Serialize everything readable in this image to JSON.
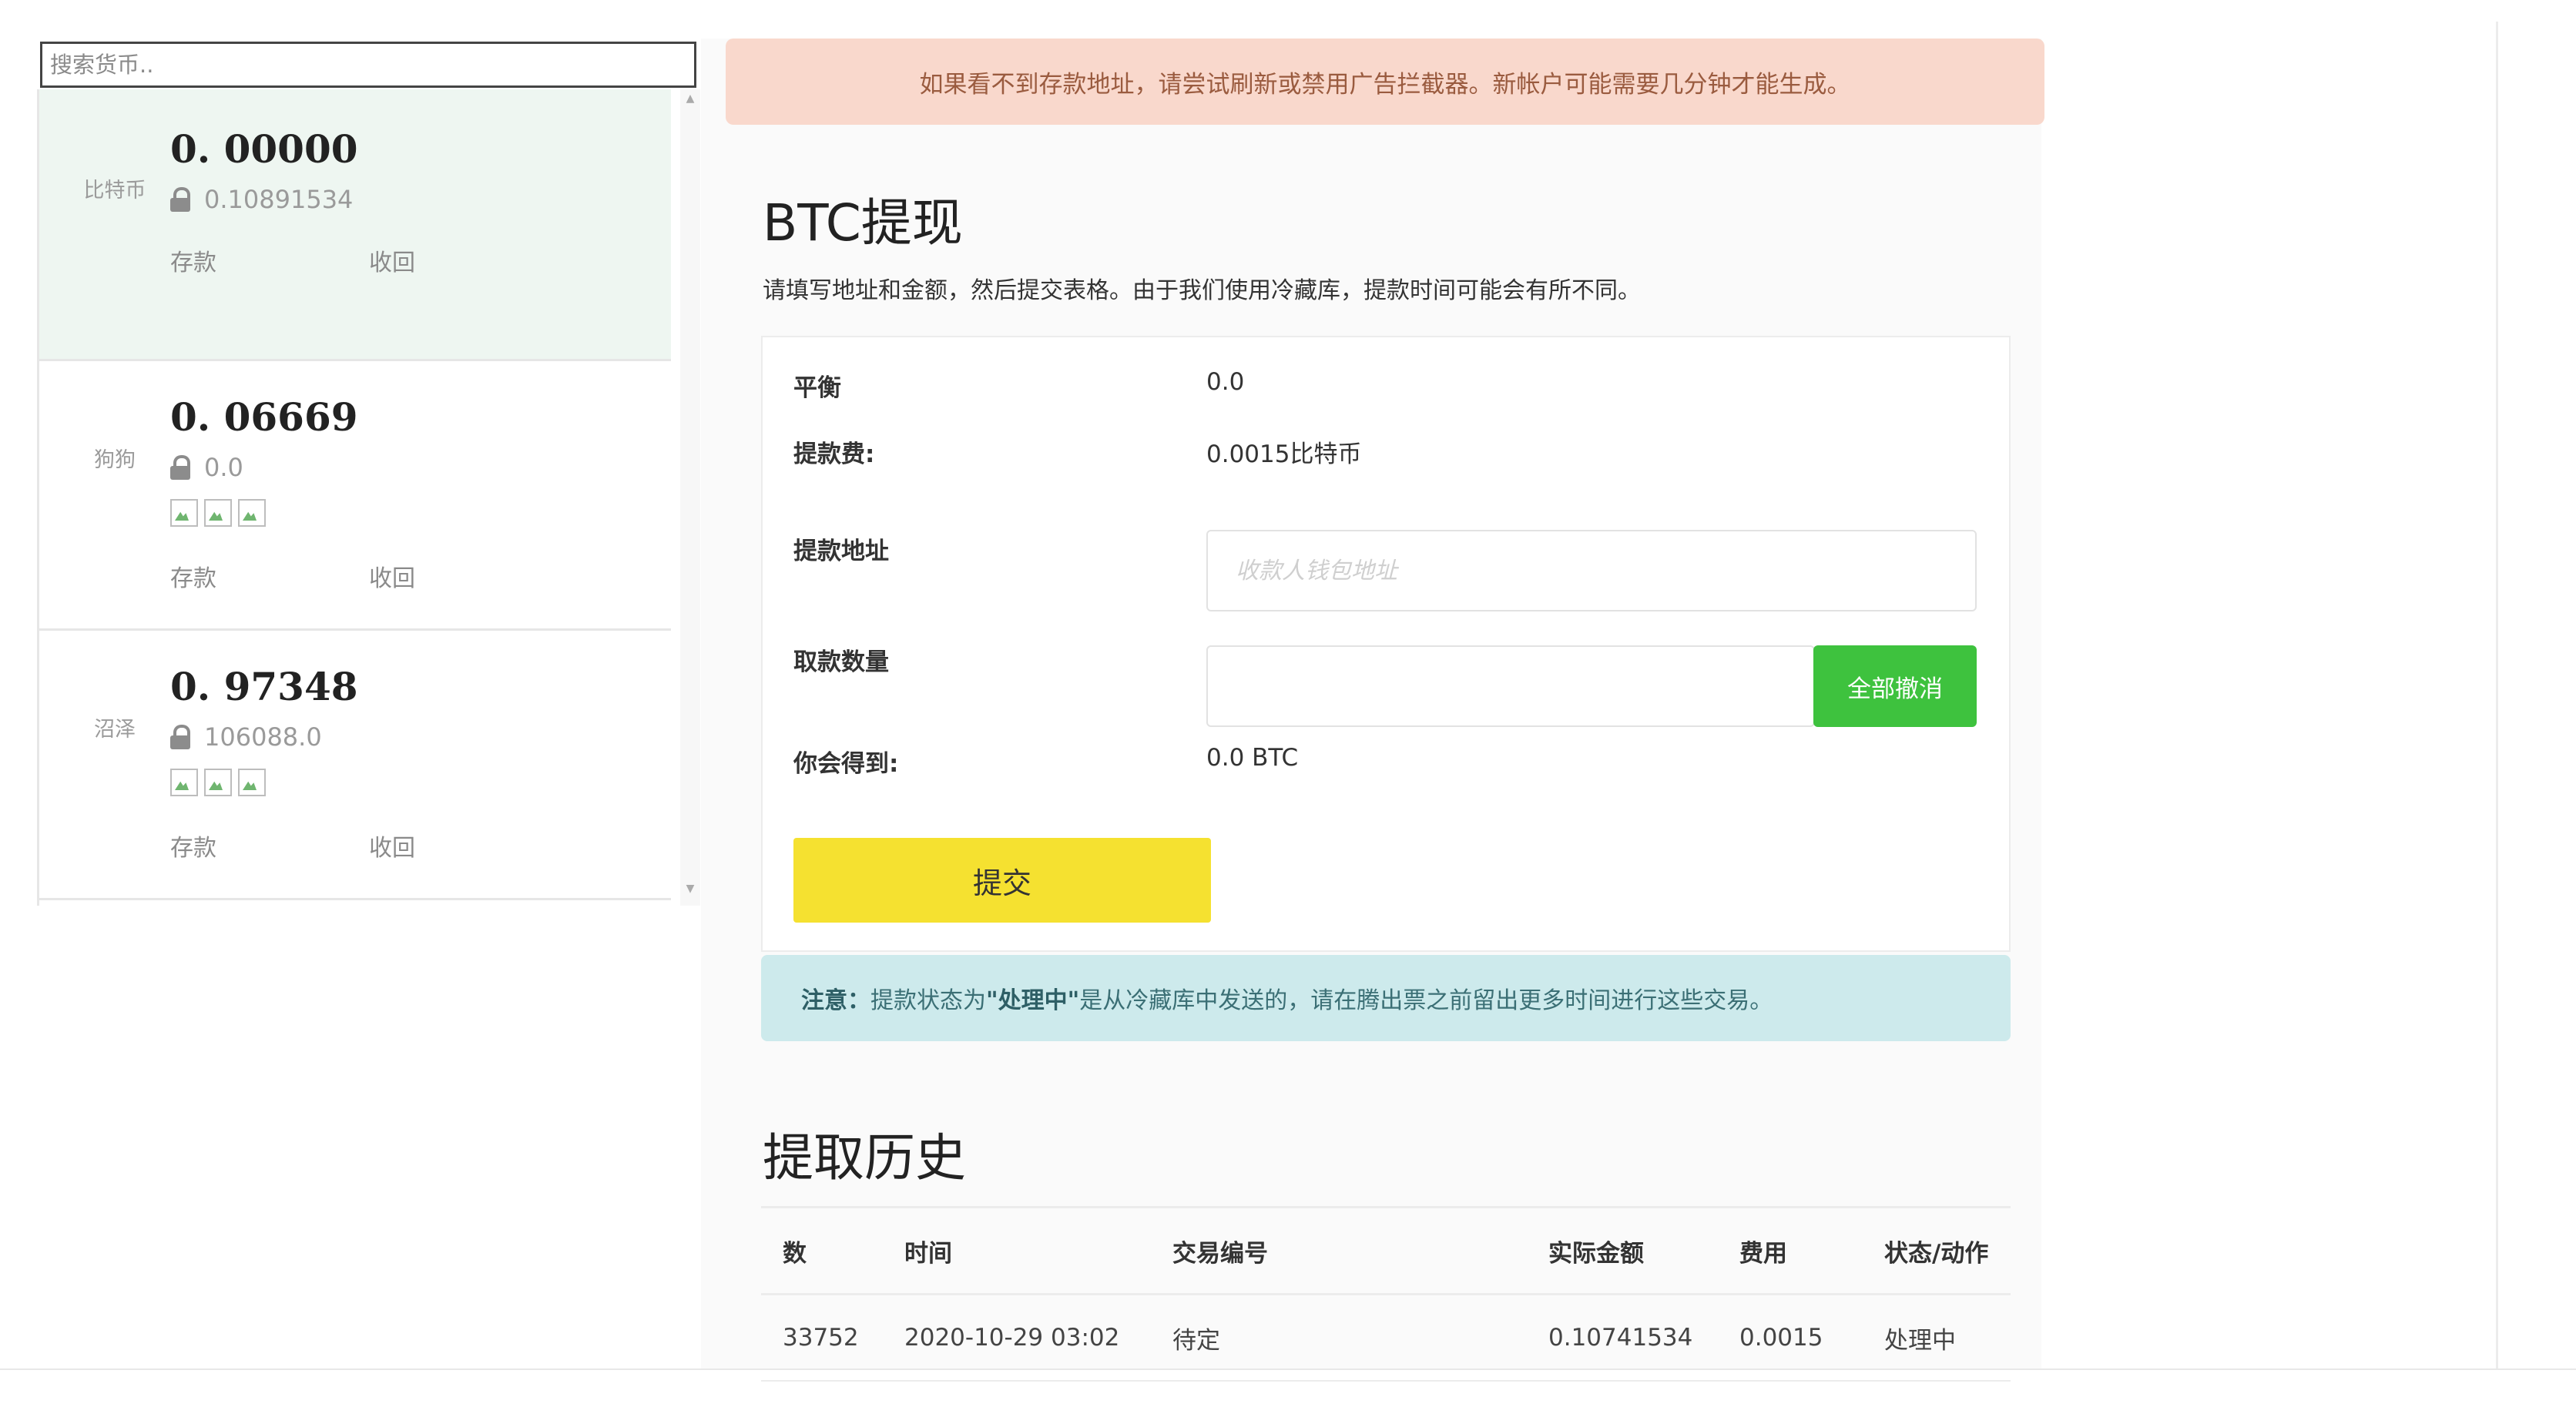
{
  "search": {
    "placeholder": "搜索货币.."
  },
  "wallets": [
    {
      "name": "比特币",
      "balance": "0. 00000",
      "locked": "0.10891534",
      "deposit": "存款",
      "withdraw": "收回",
      "active": true
    },
    {
      "name": "狗狗",
      "balance": "0. 06669",
      "locked": "0.0",
      "deposit": "存款",
      "withdraw": "收回",
      "active": false
    },
    {
      "name": "沼泽",
      "balance": "0. 97348",
      "locked": "106088.0",
      "deposit": "存款",
      "withdraw": "收回",
      "active": false
    }
  ],
  "alert": {
    "text": "如果看不到存款地址，请尝试刷新或禁用广告拦截器。新帐户可能需要几分钟才能生成。"
  },
  "page": {
    "title": "BTC提现",
    "description": "请填写地址和金额，然后提交表格。由于我们使用冷藏库，提款时间可能会有所不同。"
  },
  "form": {
    "balance_label": "平衡",
    "balance_value": "0.0",
    "fee_label": "提款费:",
    "fee_value": "0.0015比特币",
    "address_label": "提款地址",
    "address_placeholder": "收款人钱包地址",
    "amount_label": "取款数量",
    "amount_value": "",
    "max_button": "全部撤消",
    "receive_label": "你会得到:",
    "receive_value": "0.0 BTC",
    "submit_button": "提交"
  },
  "notice": {
    "prefix": "注意：",
    "part1": "提款状态为",
    "status": "\"处理中\"",
    "part2": "是从冷藏库中发送的，请在腾出票之前留出更多时间进行这些交易。"
  },
  "history": {
    "title": "提取历史",
    "columns": [
      "数",
      "时间",
      "交易编号",
      "实际金额",
      "费用",
      "状态/动作"
    ],
    "rows": [
      [
        "33752",
        "2020-10-29 03:02",
        "待定",
        "0.10741534",
        "0.0015",
        "处理中"
      ]
    ]
  },
  "colors": {
    "alert_bg": "#f9d8cc",
    "max_button": "#3ec23e",
    "submit_button": "#f5e130",
    "notice_bg": "#cdeaec",
    "active_wallet_bg": "#eef6f1"
  }
}
